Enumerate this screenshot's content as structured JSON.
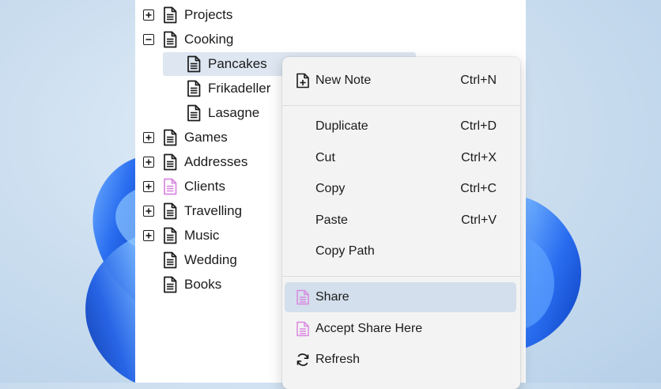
{
  "tree": {
    "items": [
      {
        "label": "Projects",
        "expander": "plus",
        "icon_color": "#1b1b1b"
      },
      {
        "label": "Cooking",
        "expander": "minus",
        "icon_color": "#1b1b1b"
      },
      {
        "label": "Pancakes",
        "expander": "none",
        "icon_color": "#1b1b1b",
        "selected": true
      },
      {
        "label": "Frikadeller",
        "expander": "none",
        "icon_color": "#1b1b1b"
      },
      {
        "label": "Lasagne",
        "expander": "none",
        "icon_color": "#1b1b1b"
      },
      {
        "label": "Games",
        "expander": "plus",
        "icon_color": "#1b1b1b"
      },
      {
        "label": "Addresses",
        "expander": "plus",
        "icon_color": "#1b1b1b"
      },
      {
        "label": "Clients",
        "expander": "plus",
        "icon_color": "#d987e0"
      },
      {
        "label": "Travelling",
        "expander": "plus",
        "icon_color": "#1b1b1b"
      },
      {
        "label": "Music",
        "expander": "plus",
        "icon_color": "#1b1b1b"
      },
      {
        "label": "Wedding",
        "expander": "none",
        "icon_color": "#1b1b1b"
      },
      {
        "label": "Books",
        "expander": "none",
        "icon_color": "#1b1b1b"
      }
    ]
  },
  "context_menu": {
    "items": [
      {
        "label": "New Note",
        "shortcut": "Ctrl+N",
        "icon": "new-note-icon"
      },
      {
        "label": "Duplicate",
        "shortcut": "Ctrl+D"
      },
      {
        "label": "Cut",
        "shortcut": "Ctrl+X"
      },
      {
        "label": "Copy",
        "shortcut": "Ctrl+C"
      },
      {
        "label": "Paste",
        "shortcut": "Ctrl+V"
      },
      {
        "label": "Copy Path",
        "shortcut": ""
      },
      {
        "label": "Share",
        "shortcut": "",
        "icon": "shared-note-icon",
        "highlighted": true
      },
      {
        "label": "Accept Share Here",
        "shortcut": "",
        "icon": "shared-note-icon"
      },
      {
        "label": "Refresh",
        "shortcut": "",
        "icon": "refresh-icon"
      }
    ]
  },
  "colors": {
    "accent_share": "#d987e0",
    "selection": "#dde6f1",
    "menu_highlight": "#d3dfec",
    "wallpaper_bloom": "#1d5fe0"
  }
}
